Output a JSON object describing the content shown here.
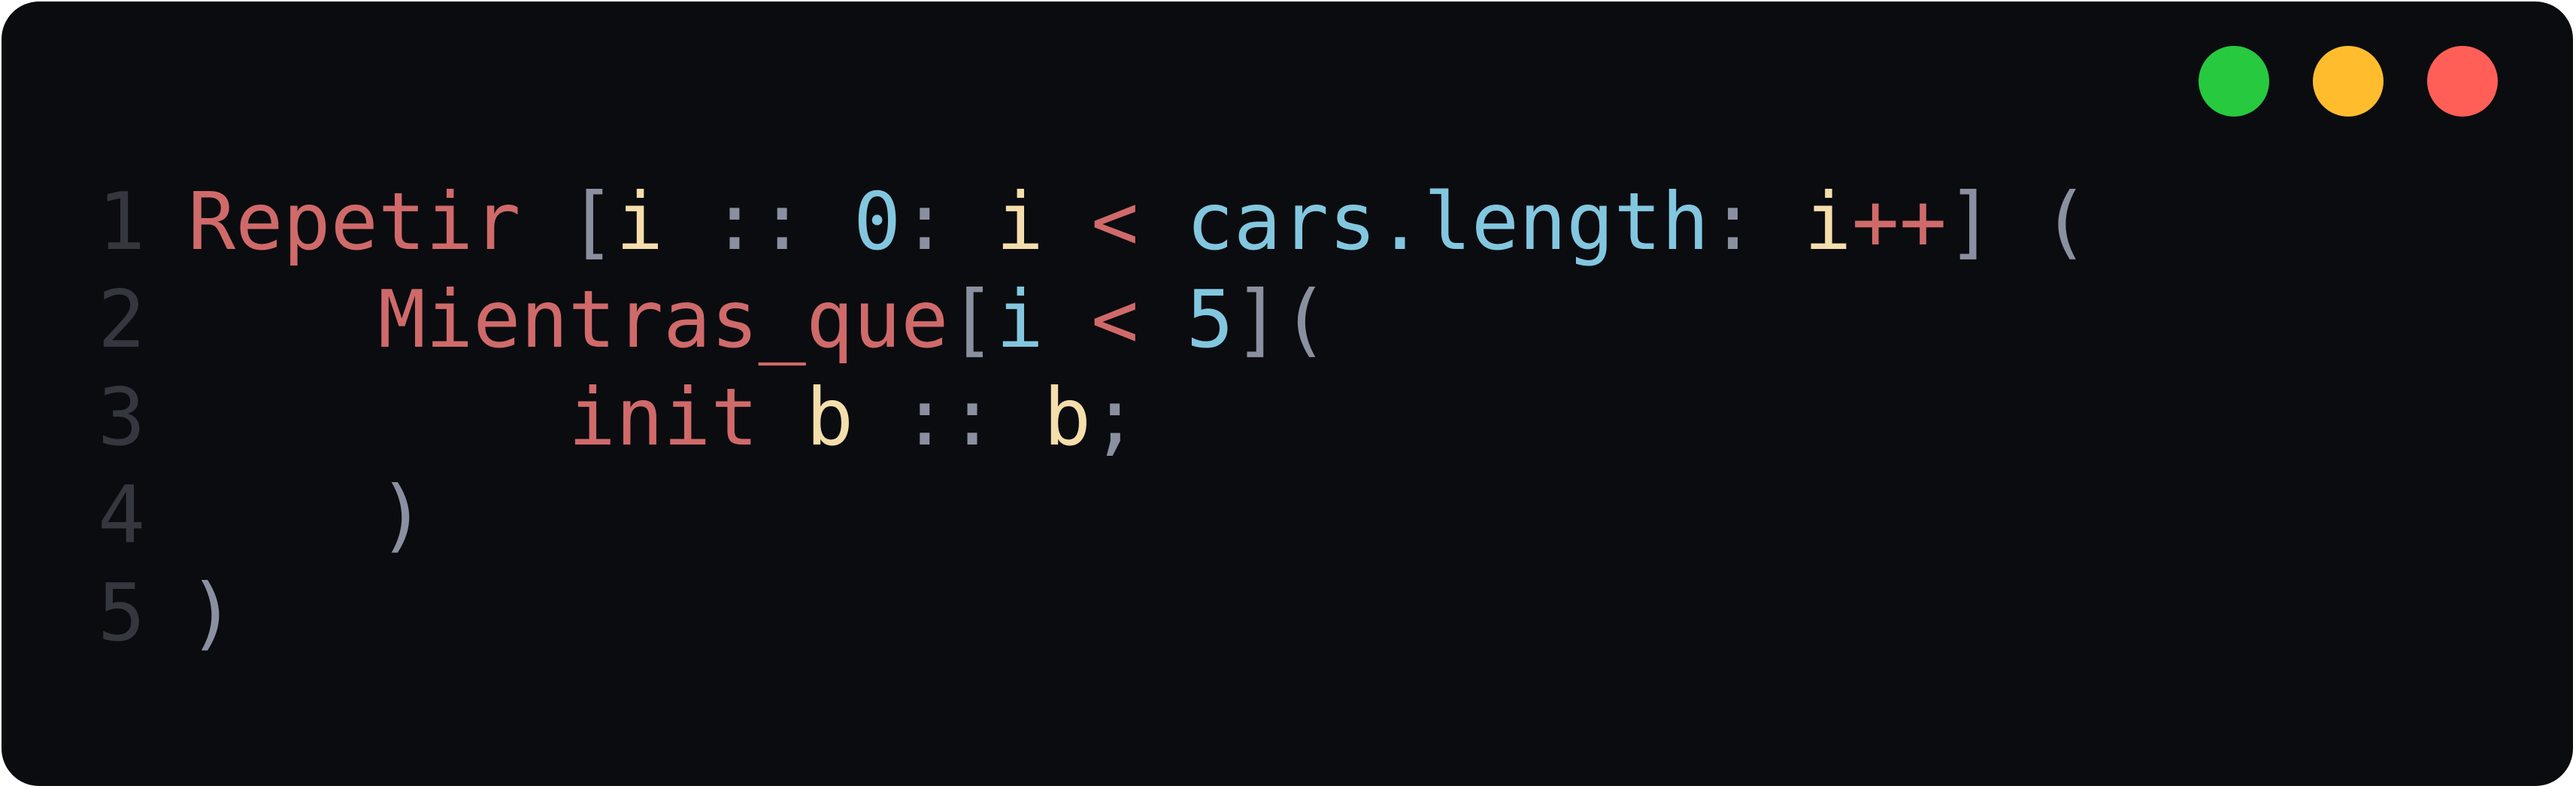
{
  "window": {
    "buttons": [
      {
        "name": "maximize-button",
        "color": "#27c93f"
      },
      {
        "name": "minimize-button",
        "color": "#ffbd2e"
      },
      {
        "name": "close-button",
        "color": "#ff5f56"
      }
    ]
  },
  "colors": {
    "keyword": "#d06a6a",
    "punct": "#8a90a0",
    "variable": "#f5deac",
    "number": "#82c7df",
    "property": "#82c7df",
    "line_number": "#34373d"
  },
  "code": {
    "lines": [
      {
        "number": "1",
        "tokens": [
          {
            "text": "Repetir",
            "kind": "keyword"
          },
          {
            "text": " ",
            "kind": "punct"
          },
          {
            "text": "[",
            "kind": "punct"
          },
          {
            "text": "i",
            "kind": "variable"
          },
          {
            "text": " :: ",
            "kind": "punct"
          },
          {
            "text": "0",
            "kind": "number"
          },
          {
            "text": ": ",
            "kind": "punct"
          },
          {
            "text": "i",
            "kind": "variable"
          },
          {
            "text": " ",
            "kind": "punct"
          },
          {
            "text": "<",
            "kind": "keyword"
          },
          {
            "text": " ",
            "kind": "punct"
          },
          {
            "text": "cars.length",
            "kind": "property"
          },
          {
            "text": ": ",
            "kind": "punct"
          },
          {
            "text": "i",
            "kind": "variable"
          },
          {
            "text": "++",
            "kind": "keyword"
          },
          {
            "text": "] (",
            "kind": "punct"
          }
        ]
      },
      {
        "number": "2",
        "tokens": [
          {
            "text": "    ",
            "kind": "punct"
          },
          {
            "text": "Mientras_que",
            "kind": "keyword"
          },
          {
            "text": "[",
            "kind": "punct"
          },
          {
            "text": "i",
            "kind": "property"
          },
          {
            "text": " ",
            "kind": "punct"
          },
          {
            "text": "<",
            "kind": "keyword"
          },
          {
            "text": " ",
            "kind": "punct"
          },
          {
            "text": "5",
            "kind": "number"
          },
          {
            "text": "](",
            "kind": "punct"
          }
        ]
      },
      {
        "number": "3",
        "tokens": [
          {
            "text": "        ",
            "kind": "punct"
          },
          {
            "text": "init",
            "kind": "keyword"
          },
          {
            "text": " ",
            "kind": "punct"
          },
          {
            "text": "b",
            "kind": "variable"
          },
          {
            "text": " :: ",
            "kind": "punct"
          },
          {
            "text": "b",
            "kind": "variable"
          },
          {
            "text": ";",
            "kind": "punct"
          }
        ]
      },
      {
        "number": "4",
        "tokens": [
          {
            "text": "    )",
            "kind": "punct"
          }
        ]
      },
      {
        "number": "5",
        "tokens": [
          {
            "text": ")",
            "kind": "punct"
          }
        ]
      }
    ]
  }
}
